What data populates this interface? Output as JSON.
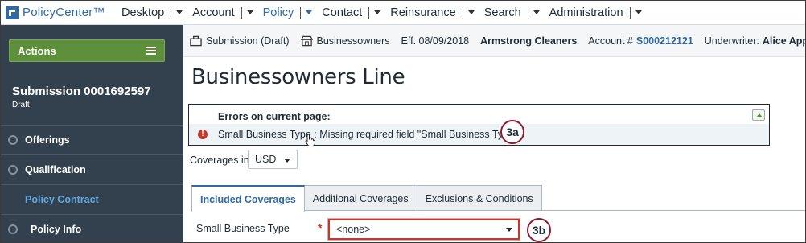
{
  "app": {
    "name": "PolicyCenter™"
  },
  "nav": [
    {
      "label": "Desktop",
      "active": false
    },
    {
      "label": "Account",
      "active": false
    },
    {
      "label": "Policy",
      "active": true
    },
    {
      "label": "Contact",
      "active": false
    },
    {
      "label": "Reinsurance",
      "active": false
    },
    {
      "label": "Search",
      "active": false
    },
    {
      "label": "Administration",
      "active": false
    }
  ],
  "sidebar": {
    "actions_label": "Actions",
    "submission_title": "Submission 0001692597",
    "submission_status": "Draft",
    "steps": [
      {
        "label": "Offerings"
      },
      {
        "label": "Qualification"
      },
      {
        "label": "Policy Contract",
        "current": true
      },
      {
        "label": "Policy Info"
      }
    ]
  },
  "infobar": {
    "job": "Submission (Draft)",
    "product": "Businessowners",
    "effective": "Eff. 08/09/2018",
    "account_name": "Armstrong Cleaners",
    "account_label": "Account #",
    "account_number": "S000212121",
    "underwriter_label": "Underwriter:",
    "underwriter_name": "Alice Applegate"
  },
  "page": {
    "title": "Businessowners Line"
  },
  "errors": {
    "heading": "Errors on current page:",
    "message": "Small Business Type : Missing required field \"Small Business Type\""
  },
  "callouts": {
    "a": "3a",
    "b": "3b"
  },
  "coverages_currency": {
    "label": "Coverages in",
    "value": "USD"
  },
  "tabs": [
    {
      "label": "Included Coverages",
      "active": true
    },
    {
      "label": "Additional Coverages",
      "active": false
    },
    {
      "label": "Exclusions & Conditions",
      "active": false
    }
  ],
  "form": {
    "small_business_type": {
      "label": "Small Business Type",
      "value": "<none>",
      "required": "*"
    }
  },
  "colors": {
    "accent": "#2f6aa6",
    "sidebar": "#33414f",
    "actions": "#5e8f3a",
    "error": "#c0392b",
    "callout_border": "#8a1c30"
  }
}
